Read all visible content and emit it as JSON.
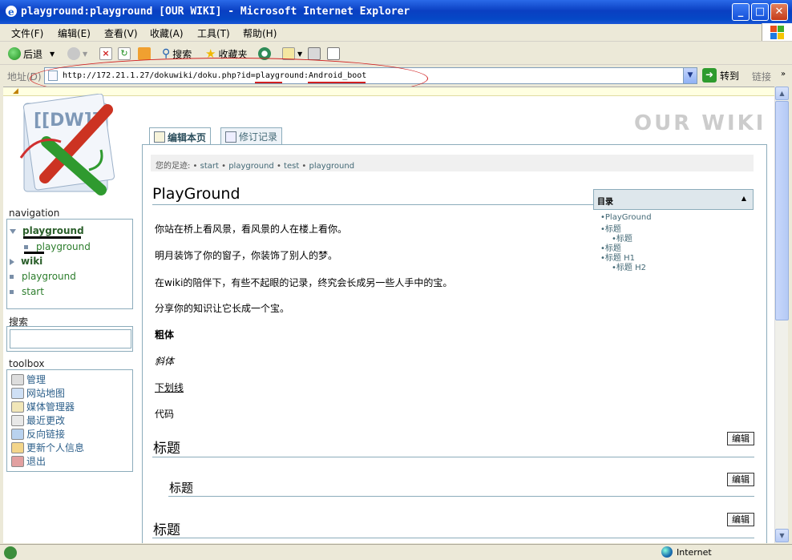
{
  "window": {
    "title": "playground:playground [OUR WIKI] - Microsoft Internet Explorer",
    "minimize": "_",
    "maximize": "□",
    "close": "✕"
  },
  "menu": [
    "文件(F)",
    "编辑(E)",
    "查看(V)",
    "收藏(A)",
    "工具(T)",
    "帮助(H)"
  ],
  "toolbar": {
    "back_label": "后退",
    "search_label": "搜索",
    "favorites_label": "收藏夹"
  },
  "address": {
    "label": "地址(D)",
    "url": "http://172.21.1.27/dokuwiki/doku.php?id=playground:Android_boot",
    "go_label": "转到",
    "links_label": "链接"
  },
  "wiki": {
    "logo_text": "[[DW]]",
    "name": "OUR WIKI",
    "tabs": [
      "编辑本页",
      "修订记录"
    ],
    "breadcrumb_prefix": "您的足迹:",
    "breadcrumbs": [
      "start",
      "playground",
      "test",
      "playground"
    ],
    "page_title": "PlayGround",
    "paragraphs": [
      "你站在桥上看风景，看风景的人在楼上看你。",
      "明月装饰了你的窗子，你装饰了别人的梦。",
      "在wiki的陪伴下，有些不起眼的记录，终究会长成另一些人手中的宝。",
      "分享你的知识让它长成一个宝。"
    ],
    "bold_text": "粗体",
    "italic_text": "斜体",
    "underline_text": "下划线",
    "code_text": "代码",
    "headings": [
      "标题",
      "标题",
      "标题"
    ],
    "edit_label": "编辑",
    "toc": {
      "title": "目录",
      "items": [
        "PlayGround",
        "标题",
        "标题",
        "标题",
        "标题 H1",
        "标题 H2"
      ]
    }
  },
  "sidebar": {
    "navigation_title": "navigation",
    "nav": [
      {
        "label": "playground",
        "type": "open"
      },
      {
        "label": "playground",
        "type": "leaf-sub"
      },
      {
        "label": "wiki",
        "type": "closed"
      },
      {
        "label": "playground",
        "type": "leaf"
      },
      {
        "label": "start",
        "type": "leaf"
      }
    ],
    "search_title": "搜索",
    "toolbox_title": "toolbox",
    "toolbox": [
      "管理",
      "网站地图",
      "媒体管理器",
      "最近更改",
      "反向链接",
      "更新个人信息",
      "退出"
    ]
  },
  "status": {
    "zone": "Internet"
  },
  "colors": {
    "titlebar": "#0a3fc2",
    "wiki_link": "#2c7d2c",
    "border": "#8cacbb",
    "annotation": "#d02020"
  }
}
